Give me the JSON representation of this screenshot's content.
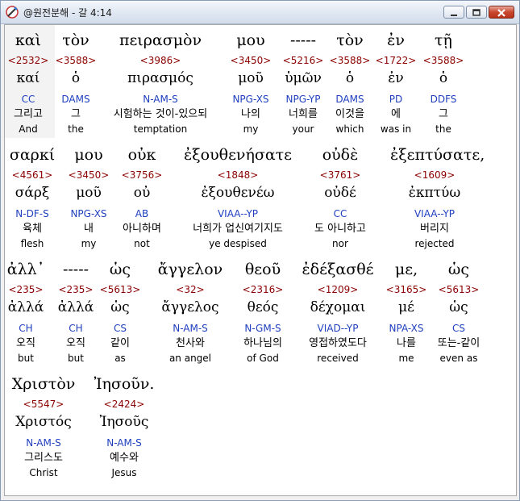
{
  "window": {
    "title": "@원전분해 - 갈 4:14"
  },
  "rows": [
    [
      {
        "g": "καὶ",
        "n": "<2532>",
        "l": "καί",
        "p": "CC",
        "k": "그리고",
        "e": "And"
      },
      {
        "g": "τὸν",
        "n": "<3588>",
        "l": "ὁ",
        "p": "DAMS",
        "k": "그",
        "e": "the"
      },
      {
        "g": "πειρασμὸν",
        "n": "<3986>",
        "l": "πιρασμός",
        "p": "N-AM-S",
        "k": "시험하는 것이-있으되",
        "e": "temptation"
      },
      {
        "g": "μου",
        "n": "<3450>",
        "l": "μοῦ",
        "p": "NPG-XS",
        "k": "나의",
        "e": "my"
      },
      {
        "g": "-----",
        "n": "<5216>",
        "l": "ὑμῶν",
        "p": "NPG-YP",
        "k": "너희를",
        "e": "your"
      },
      {
        "g": "τὸν",
        "n": "<3588>",
        "l": "ὁ",
        "p": "DAMS",
        "k": "이것을",
        "e": "which"
      },
      {
        "g": "ἐν",
        "n": "<1722>",
        "l": "ἐν",
        "p": "PD",
        "k": "에",
        "e": "was in"
      },
      {
        "g": "τῇ",
        "n": "<3588>",
        "l": "ὁ",
        "p": "DDFS",
        "k": "그",
        "e": "the"
      }
    ],
    [
      {
        "g": "σαρκί",
        "n": "<4561>",
        "l": "σάρξ",
        "p": "N-DF-S",
        "k": "육체",
        "e": "flesh"
      },
      {
        "g": "μου",
        "n": "<3450>",
        "l": "μοῦ",
        "p": "NPG-XS",
        "k": "내",
        "e": "my"
      },
      {
        "g": "οὐκ",
        "n": "<3756>",
        "l": "οὐ",
        "p": "AB",
        "k": "아니하며",
        "e": "not"
      },
      {
        "g": "ἐξουθενήσατε",
        "n": "<1848>",
        "l": "ἐξουθενέω",
        "p": "VIAA--YP",
        "k": "너희가 업신여기지도",
        "e": "ye despised"
      },
      {
        "g": "οὐδὲ",
        "n": "<3761>",
        "l": "οὐδέ",
        "p": "CC",
        "k": "도 아니하고",
        "e": "nor"
      },
      {
        "g": "ἐξεπτύσατε,",
        "n": "<1609>",
        "l": "ἐκπτύω",
        "p": "VIAA--YP",
        "k": "버리지",
        "e": "rejected"
      }
    ],
    [
      {
        "g": "ἀλλ᾽",
        "n": "<235>",
        "l": "ἀλλά",
        "p": "CH",
        "k": "오직",
        "e": "but"
      },
      {
        "g": "-----",
        "n": "<235>",
        "l": "ἀλλά",
        "p": "CH",
        "k": "오직",
        "e": "but"
      },
      {
        "g": "ὡς",
        "n": "<5613>",
        "l": "ὡς",
        "p": "CS",
        "k": "같이",
        "e": "as"
      },
      {
        "g": "ἄγγελον",
        "n": "<32>",
        "l": "ἄγγελος",
        "p": "N-AM-S",
        "k": "천사와",
        "e": "an angel"
      },
      {
        "g": "θεοῦ",
        "n": "<2316>",
        "l": "θεός",
        "p": "N-GM-S",
        "k": "하나님의",
        "e": "of God"
      },
      {
        "g": "ἐδέξασθέ",
        "n": "<1209>",
        "l": "δέχομαι",
        "p": "VIAD--YP",
        "k": "영접하였도다",
        "e": "received"
      },
      {
        "g": "με,",
        "n": "<3165>",
        "l": "μέ",
        "p": "NPA-XS",
        "k": "나를",
        "e": "me"
      },
      {
        "g": "ὡς",
        "n": "<5613>",
        "l": "ὡς",
        "p": "CS",
        "k": "또는-같이",
        "e": "even as"
      }
    ],
    [
      {
        "g": "Χριστὸν",
        "n": "<5547>",
        "l": "Χριστός",
        "p": "N-AM-S",
        "k": "그리스도",
        "e": "Christ"
      },
      {
        "g": "Ἰησοῦν.",
        "n": "<2424>",
        "l": "Ἰησοῦς",
        "p": "N-AM-S",
        "k": "예수와",
        "e": "Jesus"
      }
    ]
  ]
}
